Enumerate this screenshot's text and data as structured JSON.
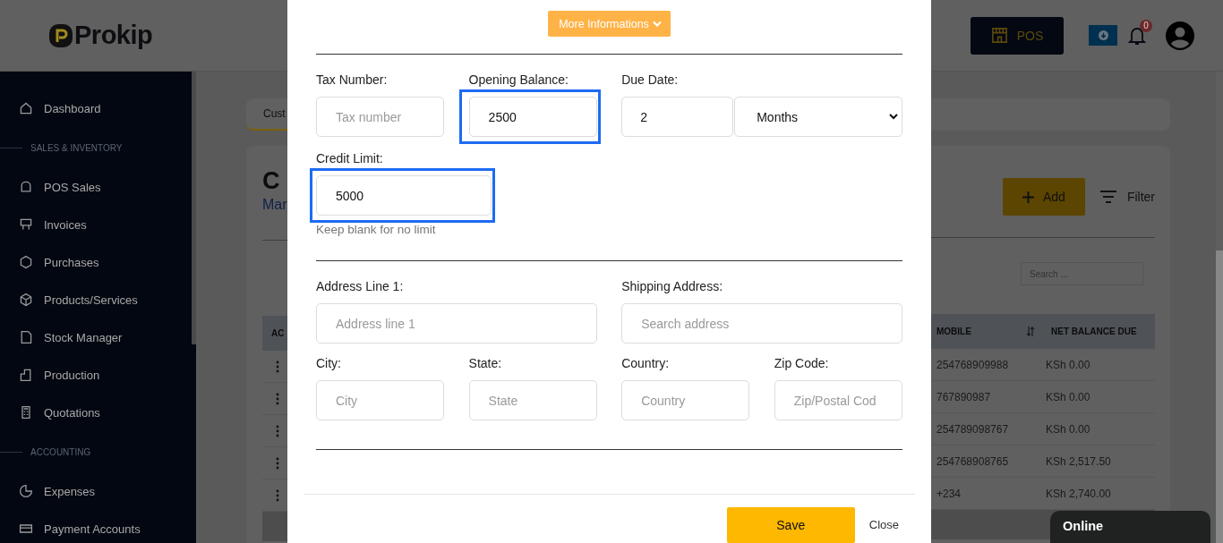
{
  "header": {
    "logo": "Prokip",
    "pos_button": "POS",
    "notification_count": "0"
  },
  "sidebar": {
    "items": [
      {
        "kind": "link",
        "label": "Dashboard"
      },
      {
        "kind": "section",
        "label": "SALES & INVENTORY"
      },
      {
        "kind": "link",
        "label": "POS Sales"
      },
      {
        "kind": "link",
        "label": "Invoices"
      },
      {
        "kind": "link",
        "label": "Purchases"
      },
      {
        "kind": "link",
        "label": "Products/Services"
      },
      {
        "kind": "link",
        "label": "Stock Manager"
      },
      {
        "kind": "link",
        "label": "Production"
      },
      {
        "kind": "link",
        "label": "Quotations"
      },
      {
        "kind": "section",
        "label": "ACCOUNTING"
      },
      {
        "kind": "link",
        "label": "Expenses"
      },
      {
        "kind": "link",
        "label": "Payment Accounts"
      }
    ]
  },
  "page": {
    "tab": "Cust",
    "title": "C",
    "subtitle": "Mar",
    "add_button": "Add",
    "filter_button": "Filter",
    "search": {
      "placeholder": "Search ..."
    },
    "table": {
      "columns": [
        "AC",
        "MOBILE",
        "NET BALANCE DUE"
      ],
      "rows": [
        {
          "mobile": "254768909988",
          "net_balance_due": "KSh 0.00"
        },
        {
          "mobile": "767890987",
          "net_balance_due": "KSh 0.00"
        },
        {
          "mobile": "254789098767",
          "net_balance_due": "KSh 0.00"
        },
        {
          "mobile": "254768908765",
          "net_balance_due": "KSh 2,517.50"
        },
        {
          "mobile": "+234",
          "net_balance_due": "KSh 2,740.00"
        }
      ]
    }
  },
  "modal": {
    "toggle_button": "More Informations",
    "tax_number": {
      "label": "Tax Number:",
      "placeholder": "Tax number"
    },
    "opening_balance": {
      "label": "Opening Balance:",
      "value": "2500",
      "highlighted": true
    },
    "due_date": {
      "label": "Due Date:",
      "value": "2",
      "unit": "Months"
    },
    "credit_limit": {
      "label": "Credit Limit:",
      "value": "5000",
      "hint": "Keep blank for no limit",
      "highlighted": true
    },
    "address_line_1": {
      "label": "Address Line 1:",
      "placeholder": "Address line 1"
    },
    "shipping_address": {
      "label": "Shipping Address:",
      "placeholder": "Search address"
    },
    "city": {
      "label": "City:",
      "placeholder": "City"
    },
    "state": {
      "label": "State:",
      "placeholder": "State"
    },
    "country": {
      "label": "Country:",
      "placeholder": "Country"
    },
    "zip_code": {
      "label": "Zip Code:",
      "placeholder": "Zip/Postal Cod"
    },
    "save_button": "Save",
    "close_button": "Close"
  },
  "chat": {
    "status": "Online"
  }
}
